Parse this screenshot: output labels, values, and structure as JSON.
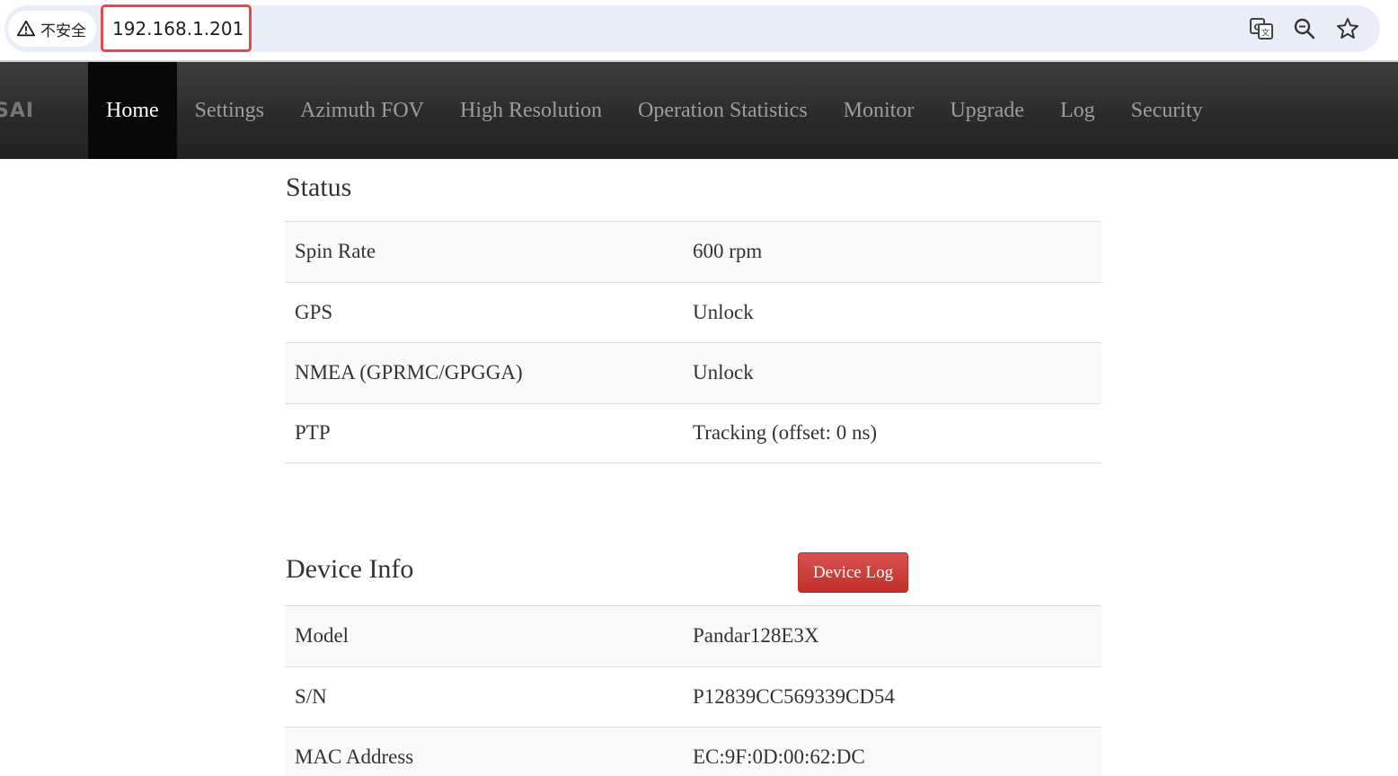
{
  "browser": {
    "security_label": "不安全",
    "url": "192.168.1.201"
  },
  "navbar": {
    "brand": "SAI",
    "items": [
      {
        "label": "Home",
        "active": true
      },
      {
        "label": "Settings"
      },
      {
        "label": "Azimuth FOV"
      },
      {
        "label": "High Resolution"
      },
      {
        "label": "Operation Statistics"
      },
      {
        "label": "Monitor"
      },
      {
        "label": "Upgrade"
      },
      {
        "label": "Log"
      },
      {
        "label": "Security"
      }
    ]
  },
  "status": {
    "title": "Status",
    "rows": [
      {
        "key": "Spin Rate",
        "value": "600 rpm"
      },
      {
        "key": "GPS",
        "value": "Unlock"
      },
      {
        "key": "NMEA (GPRMC/GPGGA)",
        "value": "Unlock"
      },
      {
        "key": "PTP",
        "value": "Tracking (offset: 0 ns)"
      }
    ]
  },
  "device_info": {
    "title": "Device Info",
    "device_log_button": "Device Log",
    "rows": [
      {
        "key": "Model",
        "value": "Pandar128E3X"
      },
      {
        "key": "S/N",
        "value": "P12839CC569339CD54"
      },
      {
        "key": "MAC Address",
        "value": "EC:9F:0D:00:62:DC"
      }
    ]
  },
  "colors": {
    "navbar_bg": "#222222",
    "nav_active_bg": "#080808",
    "nav_text": "#9d9d9d",
    "danger": "#d9534f",
    "url_highlight": "#e24b4b"
  },
  "icons": [
    "warning-icon",
    "translate-icon",
    "zoom-icon",
    "bookmark-star-icon"
  ]
}
